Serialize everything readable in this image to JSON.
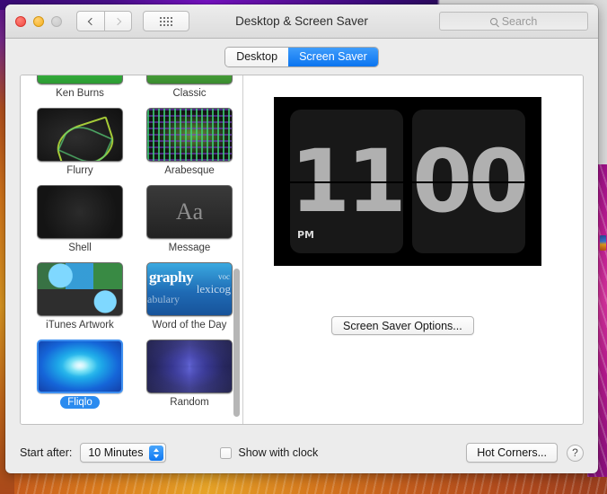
{
  "window": {
    "title": "Desktop & Screen Saver",
    "traffic_lights": [
      "close-button",
      "minimize-button",
      "zoom-button"
    ],
    "back_label": "‹",
    "forward_label": "›",
    "grid_icon": "grid-dots-icon"
  },
  "search": {
    "placeholder": "Search",
    "value": "",
    "icon": "search-icon"
  },
  "tabs": [
    {
      "label": "Desktop",
      "active": false
    },
    {
      "label": "Screen Saver",
      "active": true
    }
  ],
  "sidebar": {
    "scrollbar": "vertical-scrollbar",
    "rows": [
      [
        {
          "label": "Ken Burns",
          "art": "t-kenburns",
          "selected": false,
          "clipped": true
        },
        {
          "label": "Classic",
          "art": "t-classic",
          "selected": false,
          "clipped": true
        }
      ],
      [
        {
          "label": "Flurry",
          "art": "t-flurry",
          "selected": false
        },
        {
          "label": "Arabesque",
          "art": "t-arabesque",
          "selected": false
        }
      ],
      [
        {
          "label": "Shell",
          "art": "t-shell",
          "selected": false
        },
        {
          "label": "Message",
          "art": "t-message",
          "selected": false
        }
      ],
      [
        {
          "label": "iTunes Artwork",
          "art": "t-itunes",
          "selected": false
        },
        {
          "label": "Word of the Day",
          "art": "t-word",
          "selected": false
        }
      ],
      [
        {
          "label": "Fliqlo",
          "art": "t-fliqlo",
          "selected": true
        },
        {
          "label": "Random",
          "art": "t-random",
          "selected": false
        }
      ]
    ],
    "message_glyph": "Aa",
    "word_words": {
      "main": "graphy",
      "small1": "voc",
      "small2": "lexicog",
      "small3": "abulary"
    }
  },
  "preview": {
    "screensaver": "Fliqlo flip clock",
    "hours": "11",
    "minutes": "00",
    "meridiem": "PM",
    "options_button": "Screen Saver Options..."
  },
  "bottom": {
    "start_after_label": "Start after:",
    "start_after_value": "10 Minutes",
    "show_with_clock_label": "Show with clock",
    "show_with_clock_checked": false,
    "hot_corners_label": "Hot Corners...",
    "help_label": "?"
  },
  "colors": {
    "accent_blue": "#0a74f0",
    "selection_pill": "#2a8bef",
    "window_chrome": "#ececec",
    "panel_background": "#ffffff"
  }
}
